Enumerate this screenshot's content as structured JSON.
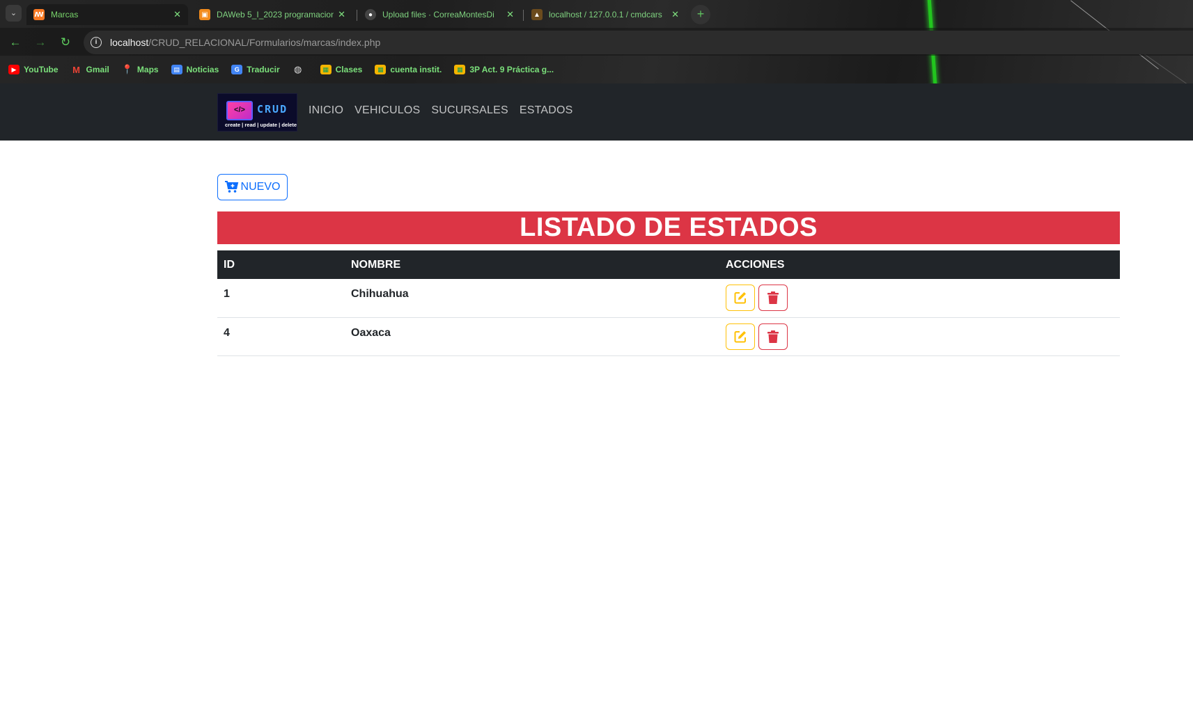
{
  "browser": {
    "tabs": [
      {
        "title": "Marcas",
        "active": true,
        "favicon": "xampp-icon"
      },
      {
        "title": "DAWeb 5_I_2023 programacion",
        "active": false,
        "favicon": "document-icon"
      },
      {
        "title": "Upload files · CorreaMontesDi",
        "active": false,
        "favicon": "github-icon"
      },
      {
        "title": "localhost / 127.0.0.1 / cmdcars",
        "active": false,
        "favicon": "phpmyadmin-icon"
      }
    ],
    "tab_close": "✕",
    "new_tab": "+",
    "url_host": "localhost",
    "url_path": "/CRUD_RELACIONAL/Formularios/marcas/index.php",
    "bookmarks": [
      {
        "label": "YouTube",
        "icon": "youtube-icon",
        "color": "#ff0000"
      },
      {
        "label": "Gmail",
        "icon": "gmail-icon",
        "color": "#ea4335"
      },
      {
        "label": "Maps",
        "icon": "maps-icon",
        "color": "#34a853"
      },
      {
        "label": "Noticias",
        "icon": "news-icon",
        "color": "#4285f4"
      },
      {
        "label": "Traducir",
        "icon": "translate-icon",
        "color": "#4285f4"
      },
      {
        "label": "",
        "icon": "globe-icon",
        "color": "#cccccc"
      },
      {
        "label": "Clases",
        "icon": "classroom-icon",
        "color": "#f4b400"
      },
      {
        "label": "cuenta instit.",
        "icon": "classroom-icon",
        "color": "#f4b400"
      },
      {
        "label": "3P Act. 9 Práctica g...",
        "icon": "classroom-icon",
        "color": "#f4b400"
      }
    ]
  },
  "navbar": {
    "brand_word": "CRUD",
    "brand_tagline": "create | read | update | delete",
    "brand_screen": "</>",
    "links": [
      "INICIO",
      "VEHICULOS",
      "SUCURSALES",
      "ESTADOS"
    ]
  },
  "main": {
    "new_button": "NUEVO",
    "heading": "LISTADO DE ESTADOS",
    "table": {
      "headers": [
        "ID",
        "NOMBRE",
        "ACCIONES"
      ],
      "rows": [
        {
          "id": "1",
          "nombre": "Chihuahua"
        },
        {
          "id": "4",
          "nombre": "Oaxaca"
        }
      ]
    }
  },
  "colors": {
    "navbar_bg": "#212529",
    "banner_bg": "#dc3545",
    "primary": "#0d6efd",
    "warning": "#ffc107",
    "danger": "#dc3545"
  }
}
